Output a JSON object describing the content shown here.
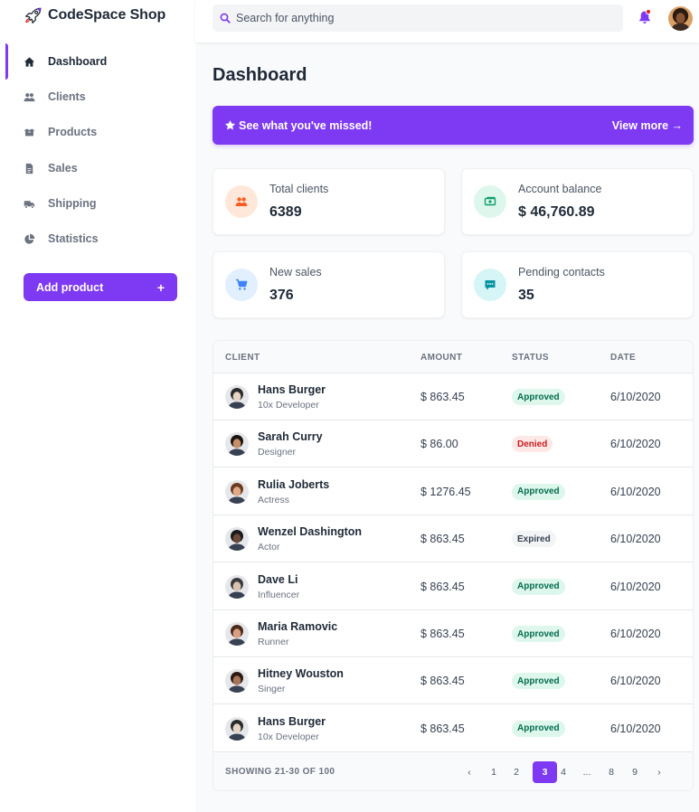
{
  "brand": {
    "name": "CodeSpace Shop",
    "logo_icon": "rocket-icon"
  },
  "colors": {
    "accent": "#7e3af2",
    "approved_bg": "#def7ec",
    "approved_fg": "#046c4e",
    "denied_bg": "#fde8e8",
    "denied_fg": "#c81e1e",
    "expired_bg": "#f3f4f6",
    "expired_fg": "#374151"
  },
  "sidebar": {
    "items": [
      {
        "label": "Dashboard",
        "icon": "home-icon",
        "active": true
      },
      {
        "label": "Clients",
        "icon": "users-icon"
      },
      {
        "label": "Products",
        "icon": "products-icon"
      },
      {
        "label": "Sales",
        "icon": "document-icon"
      },
      {
        "label": "Shipping",
        "icon": "truck-icon"
      },
      {
        "label": "Statistics",
        "icon": "pie-chart-icon"
      }
    ],
    "add_button": {
      "label": "Add product",
      "plus": "+"
    }
  },
  "header": {
    "search_placeholder": "Search for anything",
    "notification_icon": "bell-icon",
    "profile_icon": "avatar"
  },
  "main": {
    "title": "Dashboard",
    "banner": {
      "text": "See what you've missed!",
      "link": "View more →",
      "icon": "star-icon"
    },
    "cards": [
      {
        "label": "Total clients",
        "value": "6389",
        "icon": "users-icon",
        "bg": "#ffe8d9",
        "fg": "#ff5a1f"
      },
      {
        "label": "Account balance",
        "value": "$ 46,760.89",
        "icon": "cash-icon",
        "bg": "#def7ec",
        "fg": "#0e9f6e"
      },
      {
        "label": "New sales",
        "value": "376",
        "icon": "cart-icon",
        "bg": "#e1effe",
        "fg": "#3f83f8"
      },
      {
        "label": "Pending contacts",
        "value": "35",
        "icon": "chat-icon",
        "bg": "#d5f5f6",
        "fg": "#0694a2"
      }
    ],
    "table": {
      "headers": [
        "CLIENT",
        "AMOUNT",
        "STATUS",
        "DATE"
      ],
      "rows": [
        {
          "name": "Hans Burger",
          "role": "10x Developer",
          "amount": "$ 863.45",
          "status": "Approved",
          "date": "6/10/2020",
          "skin": "#e7d4c3",
          "hair": "#2b2b2b"
        },
        {
          "name": "Sarah Curry",
          "role": "Designer",
          "amount": "$ 86.00",
          "status": "Denied",
          "date": "6/10/2020",
          "skin": "#c68f6a",
          "hair": "#1c1410"
        },
        {
          "name": "Rulia Joberts",
          "role": "Actress",
          "amount": "$ 1276.45",
          "status": "Approved",
          "date": "6/10/2020",
          "skin": "#e0a98a",
          "hair": "#6b3b1f"
        },
        {
          "name": "Wenzel Dashington",
          "role": "Actor",
          "amount": "$ 863.45",
          "status": "Expired",
          "date": "6/10/2020",
          "skin": "#6b4a3a",
          "hair": "#1a1a1a"
        },
        {
          "name": "Dave Li",
          "role": "Influencer",
          "amount": "$ 863.45",
          "status": "Approved",
          "date": "6/10/2020",
          "skin": "#d9c2b0",
          "hair": "#3a3a3a"
        },
        {
          "name": "Maria Ramovic",
          "role": "Runner",
          "amount": "$ 863.45",
          "status": "Approved",
          "date": "6/10/2020",
          "skin": "#d99e84",
          "hair": "#4a2a1a"
        },
        {
          "name": "Hitney Wouston",
          "role": "Singer",
          "amount": "$ 863.45",
          "status": "Approved",
          "date": "6/10/2020",
          "skin": "#a87458",
          "hair": "#2a1a12"
        },
        {
          "name": "Hans Burger",
          "role": "10x Developer",
          "amount": "$ 863.45",
          "status": "Approved",
          "date": "6/10/2020",
          "skin": "#e7d4c3",
          "hair": "#2b2b2b"
        }
      ],
      "footer": {
        "showing": "SHOWING 21-30 OF 100",
        "prev": "‹",
        "next": "›",
        "pages": [
          "1",
          "2",
          "3",
          "4",
          "...",
          "8",
          "9"
        ],
        "current": "3"
      }
    }
  }
}
